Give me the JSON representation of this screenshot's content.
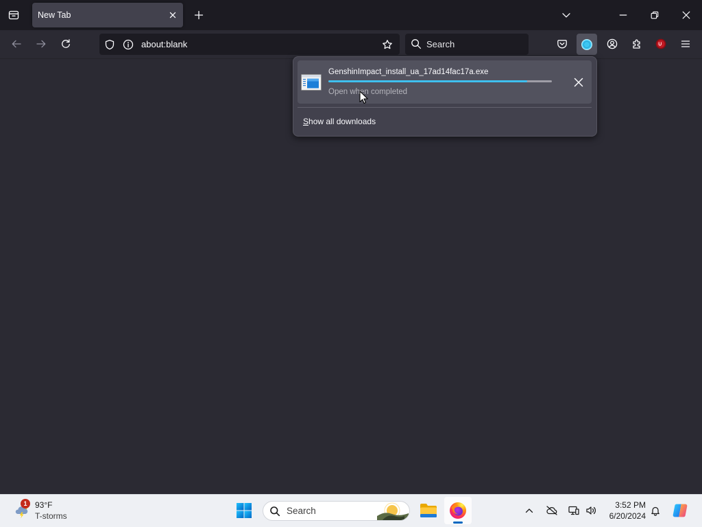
{
  "browser": {
    "tabs": [
      {
        "title": "New Tab",
        "active": true
      }
    ],
    "url": "about:blank",
    "search_placeholder": "Search"
  },
  "downloads_panel": {
    "items": [
      {
        "filename": "GenshinImpact_install_ua_17ad14fac17a.exe",
        "status": "Open when completed",
        "progress": 0.89
      }
    ],
    "show_all_label": "Show all downloads"
  },
  "taskbar": {
    "weather": {
      "temperature": "93°F",
      "condition": "T-storms",
      "notification_count": "1"
    },
    "search_placeholder": "Search",
    "clock": {
      "time": "3:52 PM",
      "date": "6/20/2024"
    }
  },
  "icons": {
    "tab_strip": [
      "firefox-view-icon",
      "tab-close-icon",
      "new-tab-icon",
      "list-all-tabs-icon",
      "minimize-icon",
      "restore-icon",
      "window-close-icon"
    ],
    "toolbar": [
      "back-arrow-icon",
      "forward-arrow-icon",
      "reload-icon",
      "tracking-protection-shield-icon",
      "site-info-icon",
      "bookmark-star-icon",
      "search-icon",
      "pocket-icon",
      "download-progress-icon",
      "account-icon",
      "extensions-icon",
      "red-addon-icon",
      "hamburger-menu-icon"
    ],
    "downloads_panel": [
      "exe-file-icon",
      "cancel-download-icon"
    ],
    "taskbar": [
      "weather-storm-icon",
      "windows-start-icon",
      "taskbar-search-icon",
      "file-explorer-icon",
      "firefox-app-icon",
      "show-hidden-icons-chevron-icon",
      "onedrive-offline-icon",
      "network-icon",
      "volume-icon",
      "notification-bell-icon",
      "copilot-icon"
    ]
  },
  "colors": {
    "tab_strip": "#1c1b22",
    "toolbar": "#2b2a33",
    "panel": "#42414d",
    "download_item": "#52525e",
    "progress_fill": "#3fc0ef",
    "progress_track": "#9f9ea7",
    "taskbar": "#eef0f4",
    "weather_badge": "#c42b1c",
    "active_app_indicator": "#0067c0"
  }
}
